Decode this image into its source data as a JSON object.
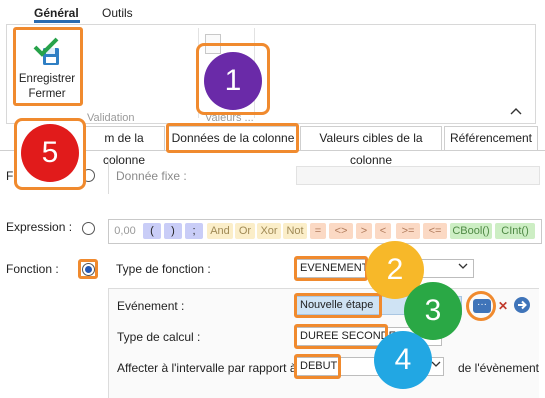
{
  "ribbon": {
    "tabs": [
      "Général",
      "Outils"
    ],
    "save_line1": "Enregistrer",
    "save_line2": "Fermer",
    "group_validation": "Validation",
    "group_valeurs": "Valeurs ...",
    "collapse_icon": "chevron-up-icon"
  },
  "column_tabs": [
    "m de la colonne",
    "Données de la colonne",
    "Valeurs cibles de la colonne",
    "Référencement"
  ],
  "form": {
    "fixed_label_fragment": "F",
    "fixed_data_label": "Donnée fixe :",
    "expression_label": "Expression :",
    "expression_tokens": [
      "0,00",
      "(",
      ")",
      ";",
      "And",
      "Or",
      "Xor",
      "Not",
      "=",
      "<>",
      ">",
      "<",
      ">=",
      "<=",
      "CBool()",
      "CInt()"
    ],
    "fonction_label": "Fonction :",
    "type_fonction_label": "Type de fonction :",
    "type_fonction_value": "EVENEMENT",
    "evenement_label": "Evénement :",
    "evenement_value": "Nouvelle étape",
    "ellipsis": "···",
    "type_calcul_label": "Type de calcul :",
    "type_calcul_value": "DUREE SECONDE",
    "affecter_label": "Affecter à l'intervalle par rapport à :",
    "affecter_value": "DEBUT",
    "affecter_suffix": "de l'évènement"
  },
  "badges": [
    "1",
    "2",
    "3",
    "4",
    "5"
  ],
  "colors": {
    "highlight": "#f08a2e",
    "badge1": "#6a2aa8",
    "badge2": "#f7b829",
    "badge3": "#2aa845",
    "badge4": "#22a7e3",
    "badge5": "#e11b1b",
    "accent": "#2357b3"
  }
}
